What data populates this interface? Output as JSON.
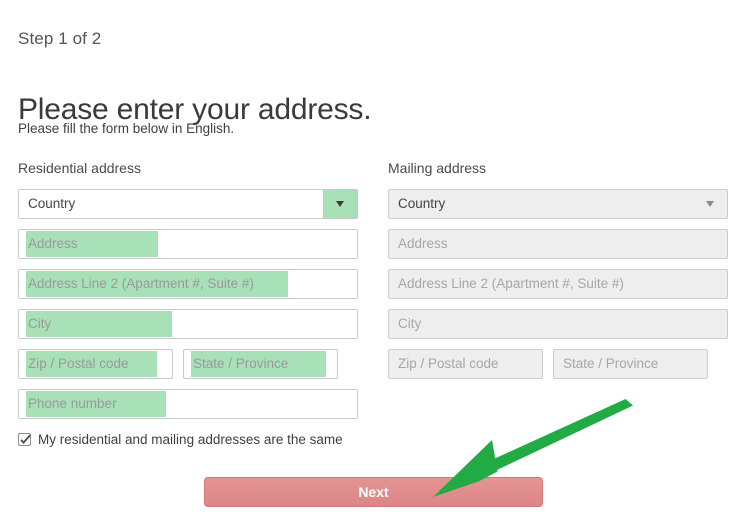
{
  "header": {
    "step": "Step 1 of 2",
    "title": "Please enter your address.",
    "subtitle": "Please fill the form below in English."
  },
  "residential": {
    "heading": "Residential address",
    "country": {
      "value": "Country",
      "caret_icon": "chevron-down-icon"
    },
    "fields": {
      "address": "Address",
      "address2": "Address Line 2 (Apartment #, Suite #)",
      "city": "City",
      "zip": "Zip / Postal code",
      "state": "State / Province",
      "phone": "Phone number"
    }
  },
  "mailing": {
    "heading": "Mailing address",
    "country": {
      "value": "Country",
      "caret_icon": "chevron-down-icon"
    },
    "fields": {
      "address": "Address",
      "address2": "Address Line 2 (Apartment #, Suite #)",
      "city": "City",
      "zip": "Zip / Postal code",
      "state": "State / Province"
    }
  },
  "same_address": {
    "label": "My residential and mailing addresses are the same",
    "checked": true,
    "check_icon": "checkmark-icon"
  },
  "next_button": {
    "label": "Next"
  },
  "annotation": {
    "arrow_icon": "arrow-pointing-to-next-button",
    "color": "#22aa44"
  },
  "colors": {
    "highlight_green": "#a8e0b8",
    "button_red": "#e08b8b",
    "button_border": "#d07777",
    "arrow_green": "#22aa44",
    "disabled_field": "#eeeeee",
    "placeholder_text": "#9a9a9a"
  }
}
